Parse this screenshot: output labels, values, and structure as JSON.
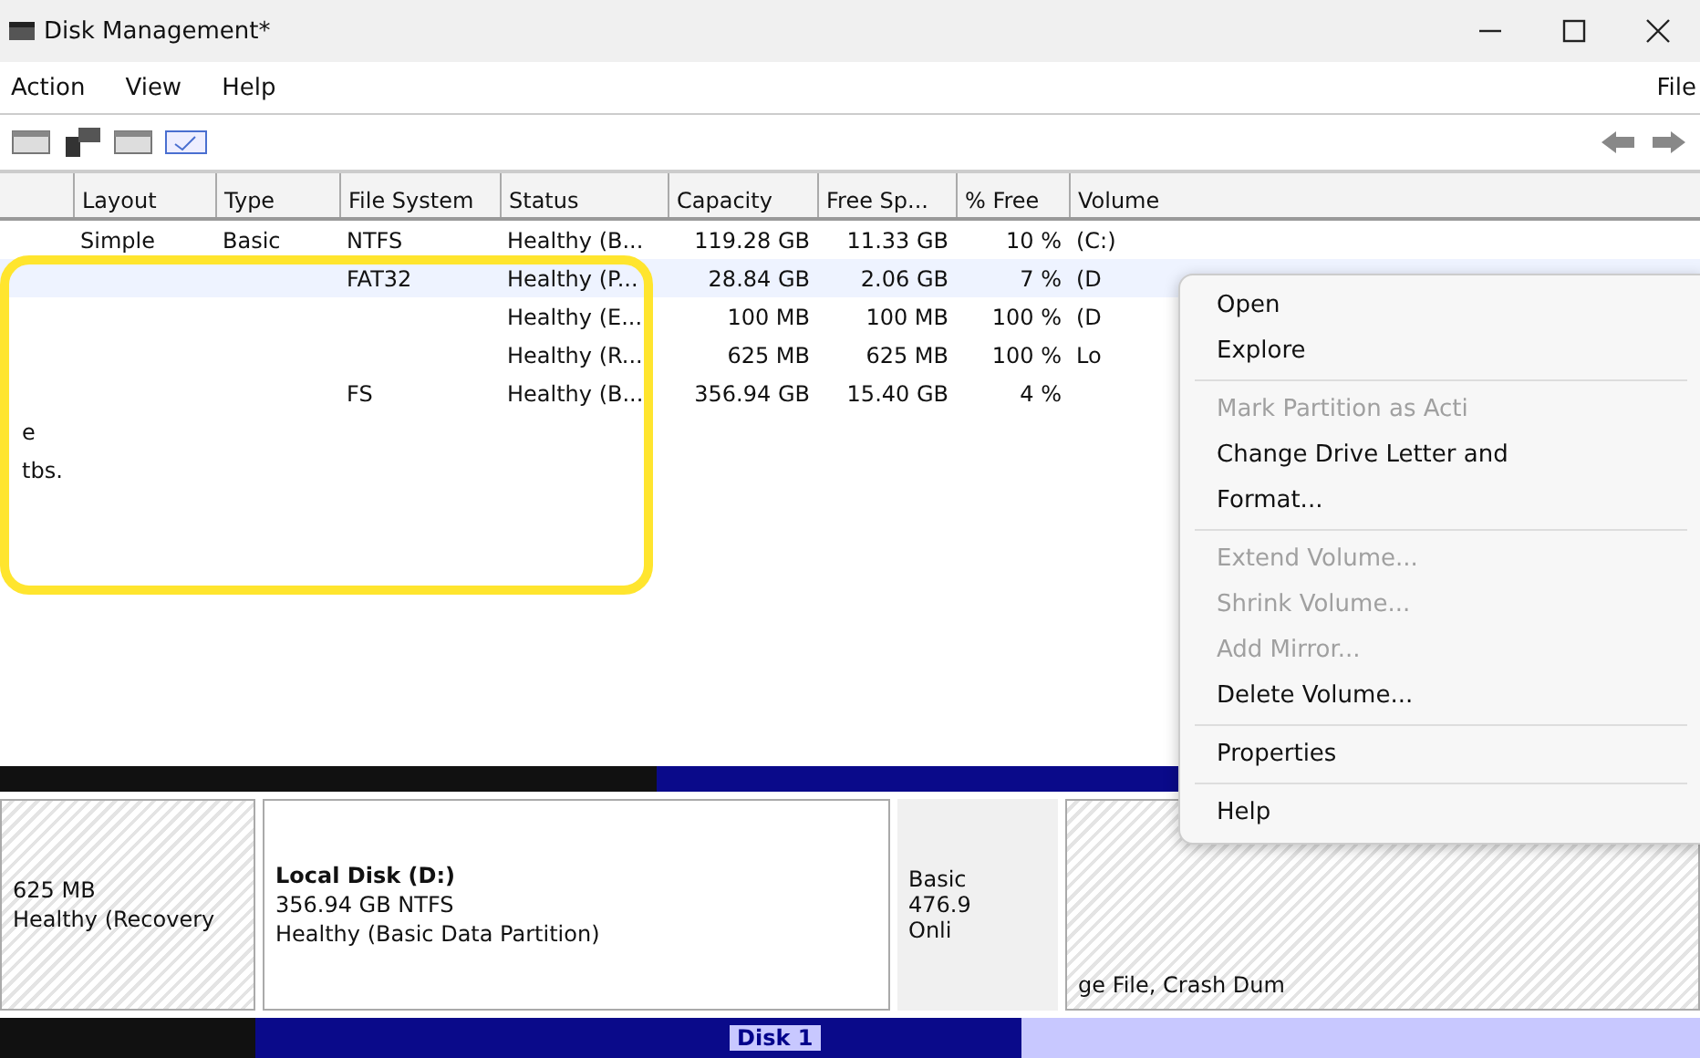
{
  "window": {
    "title": "Disk Management*"
  },
  "menu_bar": {
    "items": [
      "Action",
      "View",
      "Help"
    ],
    "right_item": "File"
  },
  "volume_table": {
    "columns": [
      "Layout",
      "Type",
      "File System",
      "Status",
      "Capacity",
      "Free Sp...",
      "% Free",
      "Volume"
    ],
    "rows": [
      {
        "column_1": "",
        "cells": [
          "Simple",
          "Basic",
          "NTFS",
          "Healthy (B...",
          "119.28 GB",
          "11.33 GB",
          "10 %",
          "(C:)"
        ],
        "selected": false
      },
      {
        "column_1": "",
        "cells": [
          "",
          "",
          "FAT32",
          "Healthy (P...",
          "28.84 GB",
          "2.06 GB",
          "7 %",
          "(D"
        ],
        "selected": true
      },
      {
        "column_1": "",
        "cells": [
          "",
          "",
          "",
          "Healthy (E...",
          "100 MB",
          "100 MB",
          "100 %",
          "(D"
        ],
        "selected": false
      },
      {
        "column_1": "",
        "cells": [
          "",
          "",
          "",
          "Healthy (R...",
          "625 MB",
          "625 MB",
          "100 %",
          "Lo"
        ],
        "selected": false
      },
      {
        "column_1": "",
        "cells": [
          "",
          "",
          "FS",
          "Healthy (B...",
          "356.94 GB",
          "15.40 GB",
          "4 %",
          ""
        ],
        "selected": false
      },
      {
        "column_1": "e",
        "cells": [],
        "selected": false
      },
      {
        "column_1": "tbs.",
        "cells": [],
        "selected": false
      }
    ]
  },
  "context_menu": [
    {
      "label": "Open",
      "disabled": false,
      "separator_before": false
    },
    {
      "label": "Explore",
      "disabled": false,
      "separator_before": false
    },
    {
      "label": "Mark Partition as Acti",
      "disabled": true,
      "separator_before": true
    },
    {
      "label": "Change Drive Letter and",
      "disabled": false,
      "separator_before": false
    },
    {
      "label": "Format...",
      "disabled": false,
      "separator_before": false
    },
    {
      "label": "Extend Volume...",
      "disabled": true,
      "separator_before": true
    },
    {
      "label": "Shrink Volume...",
      "disabled": true,
      "separator_before": false
    },
    {
      "label": "Add Mirror...",
      "disabled": true,
      "separator_before": false
    },
    {
      "label": "Delete Volume...",
      "disabled": false,
      "separator_before": false
    },
    {
      "label": "Properties",
      "disabled": false,
      "separator_before": true
    },
    {
      "label": "Help",
      "disabled": false,
      "separator_before": true
    }
  ],
  "disk_map": {
    "partitions": [
      {
        "kind": "partition",
        "lines": [
          "625 MB",
          "Healthy (Recovery"
        ]
      },
      {
        "kind": "partition",
        "name": "Local Disk (D:)",
        "lines": [
          "356.94 GB NTFS",
          "Healthy (Basic Data Partition)"
        ]
      },
      {
        "kind": "disk",
        "lines": [
          "Basic",
          "476.9",
          "Onli"
        ]
      },
      {
        "kind": "partition",
        "lines": [
          "ge File, Crash Dum"
        ]
      }
    ],
    "next_disk": "Disk 1"
  }
}
